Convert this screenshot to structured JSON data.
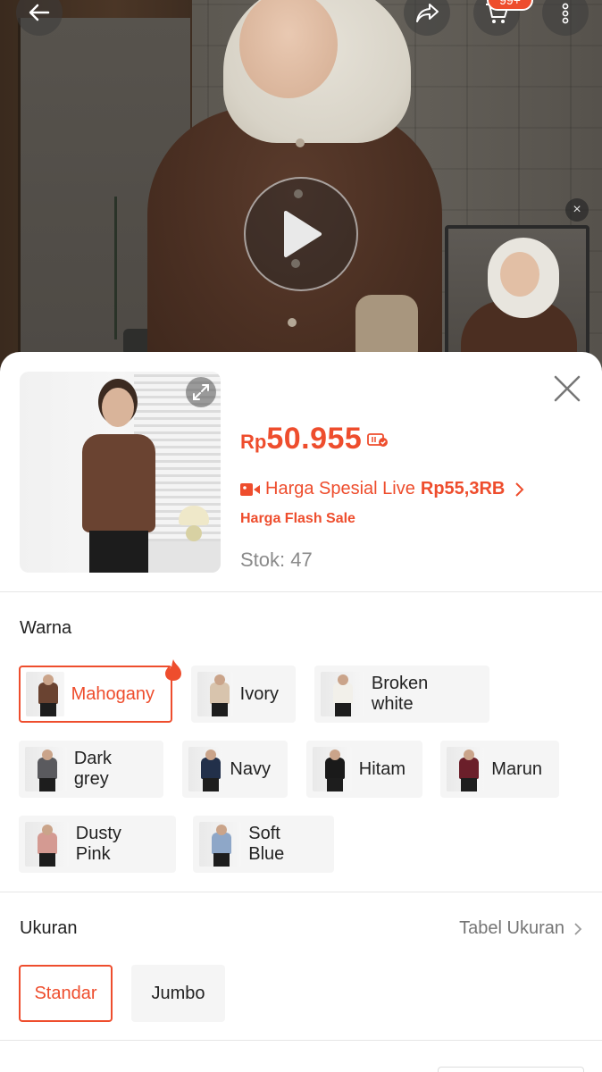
{
  "header": {
    "back_icon": "arrow-left-icon",
    "share_icon": "share-icon",
    "cart_icon": "cart-icon",
    "cart_badge": "99+",
    "more_icon": "more-vertical-icon"
  },
  "media": {
    "play_icon": "play-icon",
    "thumb_close": "×"
  },
  "product": {
    "currency": "Rp",
    "price": "50.955",
    "live_label": "Harga Spesial Live",
    "live_price": "Rp55,3RB",
    "flash_prefix": "Harga ",
    "flash_label": "Flash Sale",
    "stock": "Stok: 47"
  },
  "color_section": {
    "label": "Warna",
    "options": [
      {
        "label": "Mahogany",
        "selected": true,
        "tone": "#6a4331"
      },
      {
        "label": "Ivory",
        "selected": false,
        "tone": "#d8c4ad"
      },
      {
        "label": "Broken white",
        "selected": false,
        "tone": "#f2f0ea"
      },
      {
        "label": "Dark grey",
        "selected": false,
        "tone": "#5a5a5e"
      },
      {
        "label": "Navy",
        "selected": false,
        "tone": "#22304a"
      },
      {
        "label": "Hitam",
        "selected": false,
        "tone": "#1a1a1a"
      },
      {
        "label": "Marun",
        "selected": false,
        "tone": "#6b1f2a"
      },
      {
        "label": "Dusty Pink",
        "selected": false,
        "tone": "#d49a92"
      },
      {
        "label": "Soft Blue",
        "selected": false,
        "tone": "#8ea7c8"
      }
    ]
  },
  "size_section": {
    "label": "Ukuran",
    "chart_link": "Tabel Ukuran",
    "options": [
      {
        "label": "Standar",
        "selected": true
      },
      {
        "label": "Jumbo",
        "selected": false
      }
    ]
  },
  "colors": {
    "accent": "#ee4d2d",
    "chip_bg": "#f5f5f5",
    "muted_text": "#8a8a8a"
  }
}
